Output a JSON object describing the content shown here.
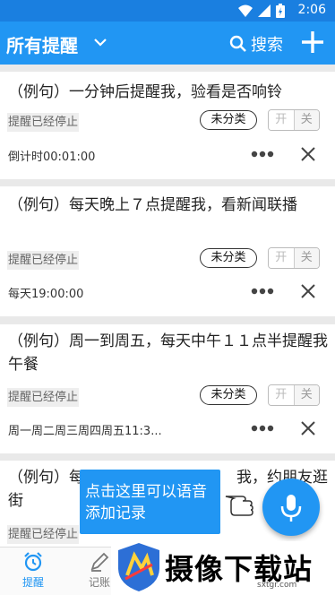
{
  "status_bar": {
    "time": "2:06"
  },
  "app_bar": {
    "title": "所有提醒",
    "search_label": "搜索"
  },
  "reminders": [
    {
      "text": "（例句）一分钟后提醒我，验看是否响铃",
      "status": "提醒已经停止",
      "category": "未分类",
      "toggle_on": "开",
      "toggle_off": "关",
      "schedule": "倒计时00:01:00"
    },
    {
      "text": "（例句）每天晚上７点提醒我，看新闻联播",
      "status": "提醒已经停止",
      "category": "未分类",
      "toggle_on": "开",
      "toggle_off": "关",
      "schedule": "每天19:00:00"
    },
    {
      "text": "（例句）周一到周五，每天中午１１点半提醒我午餐",
      "status": "提醒已经停止",
      "category": "未分类",
      "toggle_on": "开",
      "toggle_off": "关",
      "schedule": "周一周二周三周四周五11:3..."
    },
    {
      "text": "（例句）每　　　　　　　　　　我，约朋友逛街",
      "status": "提醒已经停止"
    }
  ],
  "voice_tip": "点击这里可以语音添加记录",
  "bottom_nav": [
    {
      "label": "提醒",
      "active": true
    },
    {
      "label": "记账",
      "active": false
    }
  ],
  "watermark": {
    "text": "摄像下载站",
    "url": "sxtgr.com"
  },
  "colors": {
    "primary": "#2196f3",
    "status_bar": "#1a7fe0"
  }
}
